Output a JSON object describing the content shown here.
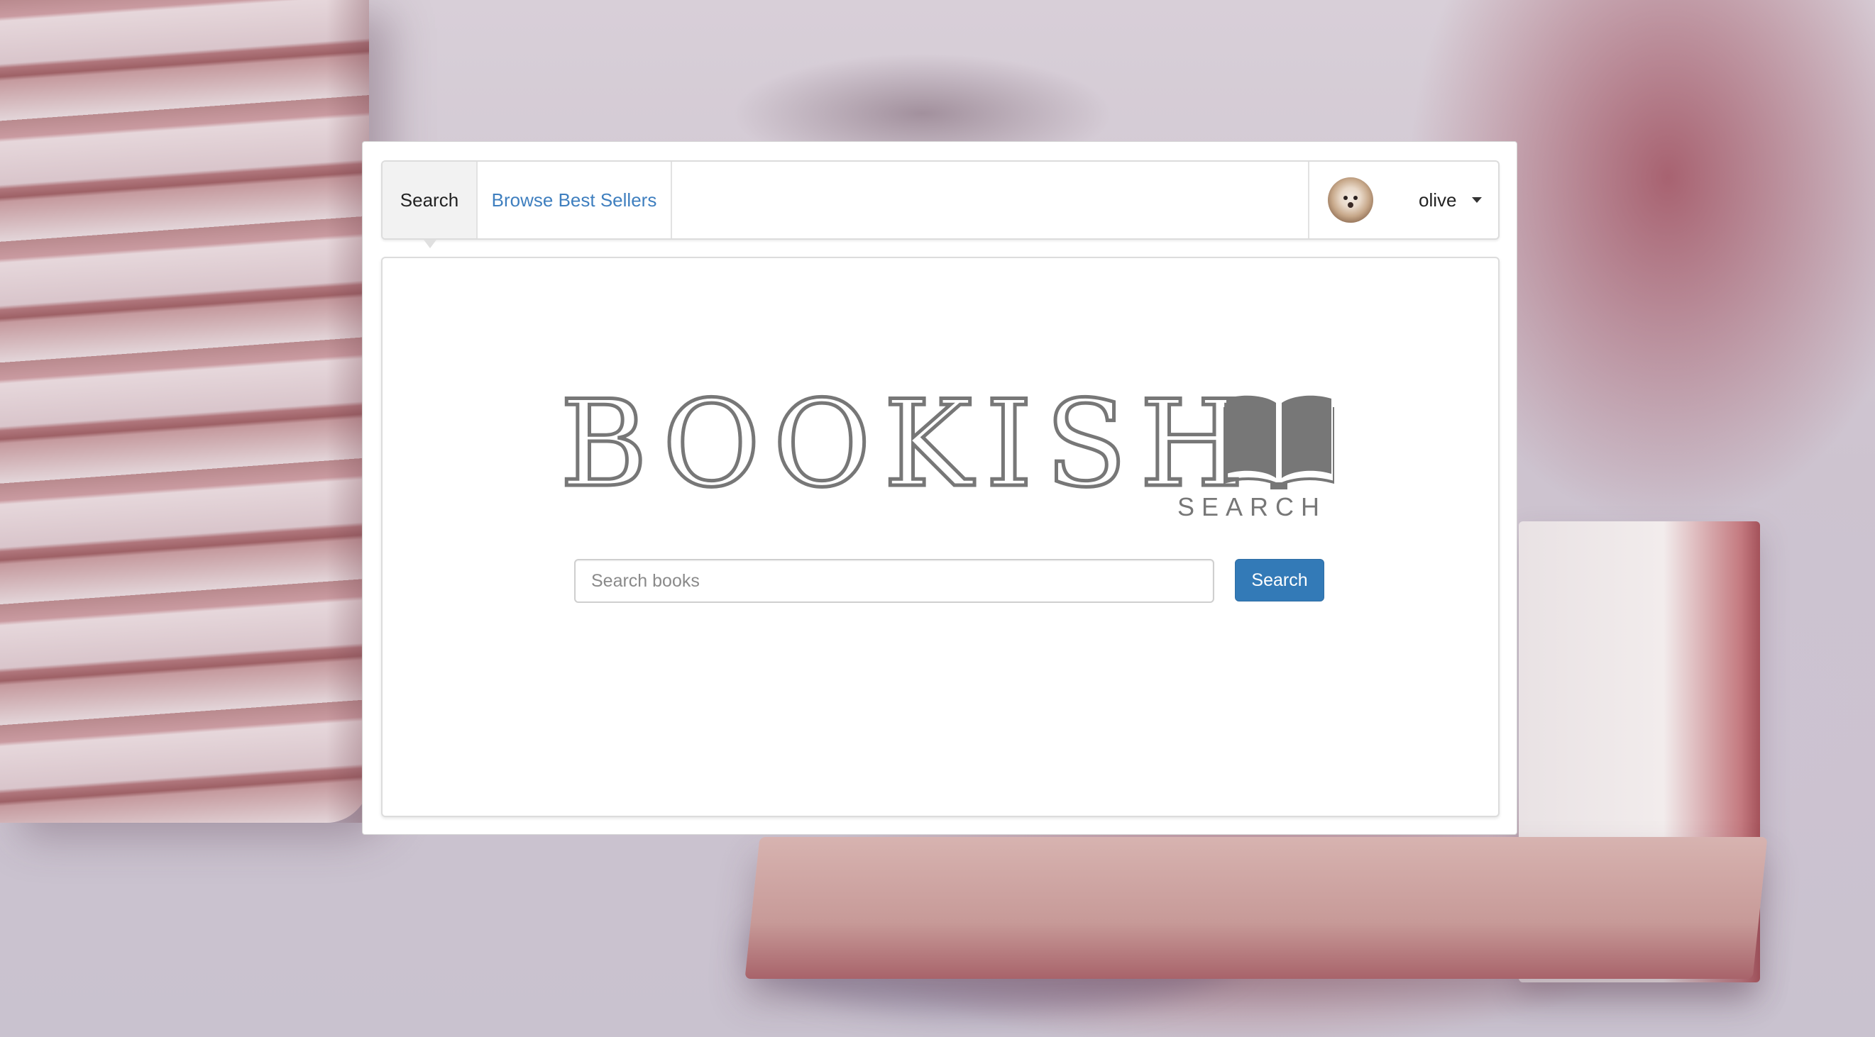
{
  "nav": {
    "tabs": [
      {
        "label": "Search",
        "active": true
      },
      {
        "label": "Browse Best Sellers",
        "active": false
      }
    ],
    "user": {
      "name": "olive",
      "avatar_icon": "dog-avatar"
    }
  },
  "logo": {
    "title": "BOOKISH",
    "subtitle": "SEARCH",
    "icon": "open-book-icon",
    "color": "#777777"
  },
  "search": {
    "placeholder": "Search books",
    "value": "",
    "button_label": "Search"
  },
  "colors": {
    "primary": "#337ab7",
    "link": "#3f7fbf"
  }
}
